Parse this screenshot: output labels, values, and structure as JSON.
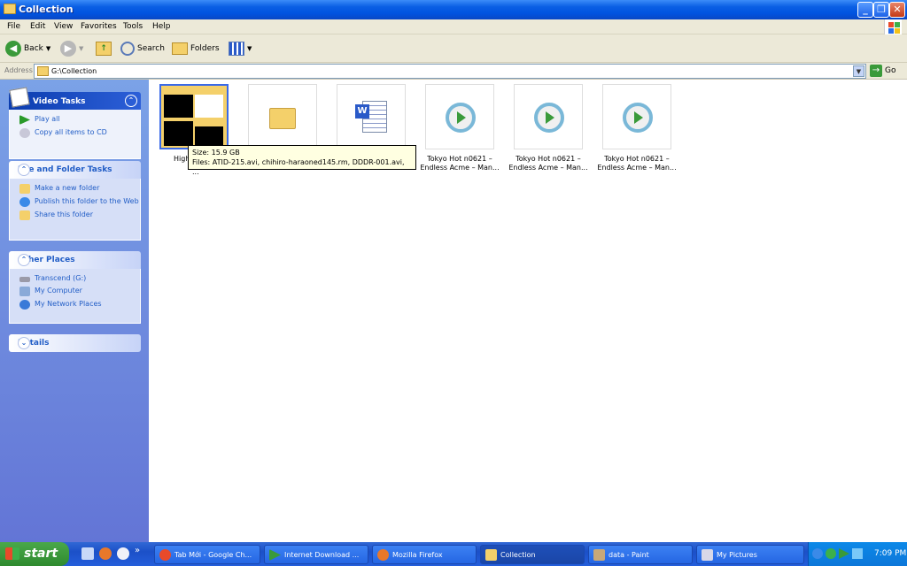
{
  "window": {
    "title": "Collection"
  },
  "menu": [
    "File",
    "Edit",
    "View",
    "Favorites",
    "Tools",
    "Help"
  ],
  "toolbar": {
    "back": "Back",
    "search": "Search",
    "folders": "Folders"
  },
  "address": {
    "label": "Address",
    "value": "G:\\Collection",
    "go": "Go"
  },
  "sidebar": {
    "video_tasks": {
      "title": "Video Tasks",
      "items": [
        "Play all",
        "Copy all items to CD"
      ]
    },
    "file_folder_tasks": {
      "title": "File and Folder Tasks",
      "items": [
        "Make a new folder",
        "Publish this folder to the Web",
        "Share this folder"
      ]
    },
    "other_places": {
      "title": "Other Places",
      "items": [
        "Transcend (G:)",
        "My Computer",
        "My Network Places"
      ]
    },
    "details": {
      "title": "Details"
    }
  },
  "files": [
    {
      "label": "High",
      "icon": "folder-thumbnail-icon"
    },
    {
      "label": "",
      "icon": "folder-icon"
    },
    {
      "label": "",
      "icon": "word-document-icon"
    },
    {
      "label": "Tokyo Hot n0621 – Endless Acme – Man...",
      "icon": "media-file-icon"
    },
    {
      "label": "Tokyo Hot n0621 – Endless Acme – Man...",
      "icon": "media-file-icon"
    },
    {
      "label": "Tokyo Hot n0621 – Endless Acme – Man...",
      "icon": "media-file-icon"
    }
  ],
  "tooltip": {
    "size": "Size: 15.9 GB",
    "files": "Files: ATID-215.avi, chihiro-haraoned145.rm, DDDR-001.avi, ..."
  },
  "taskbar": {
    "start": "start",
    "tasks": [
      "Tab Mới - Google Ch...",
      "Internet Download ...",
      "Mozilla Firefox",
      "Collection",
      "data - Paint",
      "My Pictures"
    ],
    "clock": "7:09 PM"
  }
}
